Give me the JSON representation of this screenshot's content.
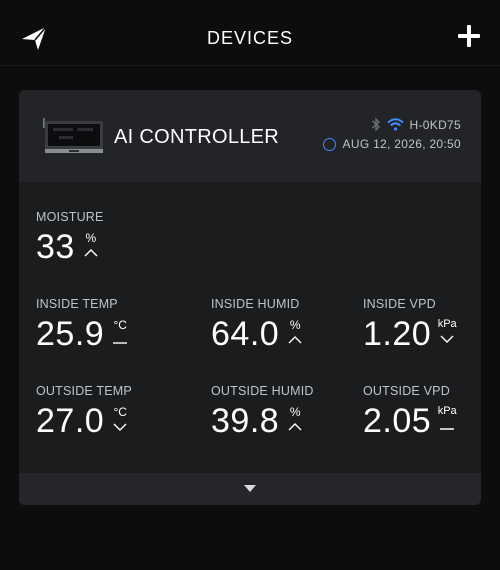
{
  "header": {
    "title": "DEVICES",
    "logo_icon": "arrow-logo-icon",
    "add_icon": "plus-icon"
  },
  "device": {
    "name": "AI CONTROLLER",
    "id": "H-0KD75",
    "timestamp": "AUG 12, 2026, 20:50",
    "connectivity_icons": [
      "bluetooth-icon",
      "wifi-icon"
    ],
    "colors": {
      "wifi": "#3f8cff",
      "clock": "#3f8cff"
    }
  },
  "metrics": [
    {
      "label": "MOISTURE",
      "value": "33",
      "unit": "%",
      "trend": "up"
    },
    {
      "label": "INSIDE TEMP",
      "value": "25.9",
      "unit": "°C",
      "trend": "flat"
    },
    {
      "label": "INSIDE HUMID",
      "value": "64.0",
      "unit": "%",
      "trend": "up"
    },
    {
      "label": "INSIDE VPD",
      "value": "1.20",
      "unit": "kPa",
      "trend": "down"
    },
    {
      "label": "OUTSIDE TEMP",
      "value": "27.0",
      "unit": "°C",
      "trend": "down"
    },
    {
      "label": "OUTSIDE HUMID",
      "value": "39.8",
      "unit": "%",
      "trend": "up"
    },
    {
      "label": "OUTSIDE VPD",
      "value": "2.05",
      "unit": "kPa",
      "trend": "flat"
    }
  ],
  "expand_icon": "caret-down-icon"
}
